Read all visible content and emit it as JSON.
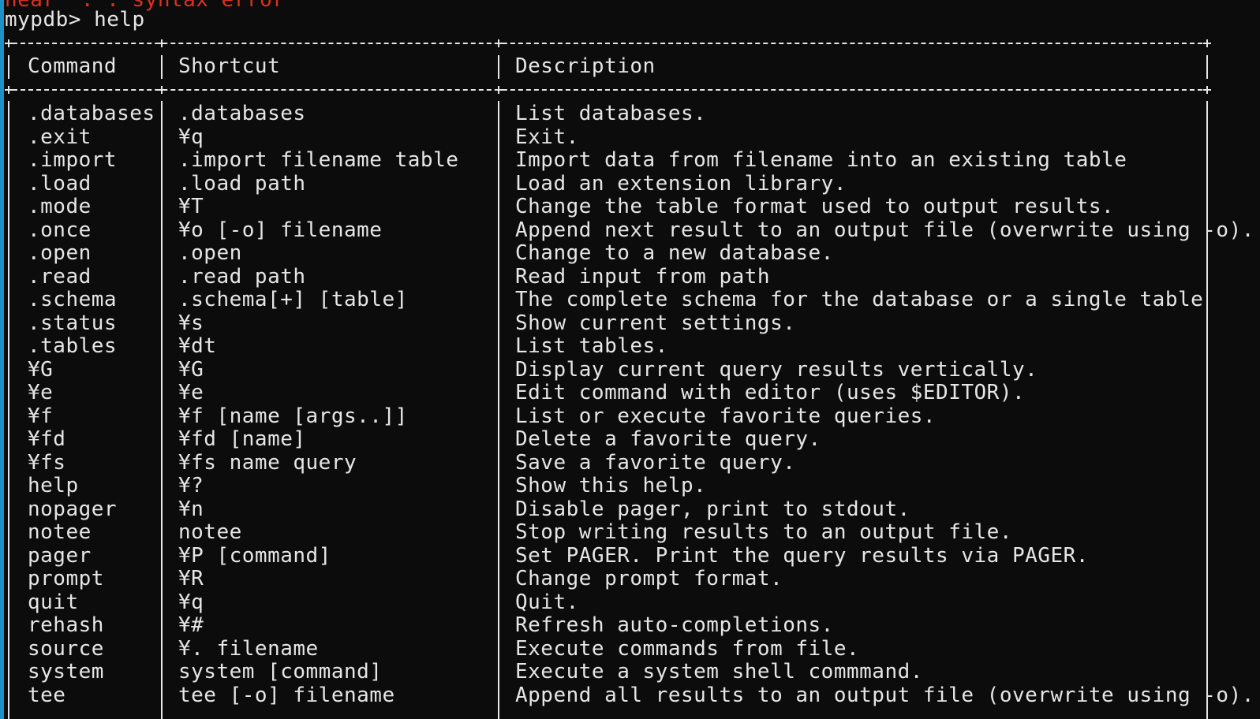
{
  "terminal": {
    "error_text": "near \".\": syntax error",
    "prompt": "mypdb> ",
    "command": "help"
  },
  "table": {
    "headers": [
      "Command",
      "Shortcut",
      "Description"
    ],
    "rows": [
      {
        "command": ".databases",
        "shortcut": ".databases",
        "description": "List databases."
      },
      {
        "command": ".exit",
        "shortcut": "¥q",
        "description": "Exit."
      },
      {
        "command": ".import",
        "shortcut": ".import filename table",
        "description": "Import data from filename into an existing table"
      },
      {
        "command": ".load",
        "shortcut": ".load path",
        "description": "Load an extension library."
      },
      {
        "command": ".mode",
        "shortcut": "¥T",
        "description": "Change the table format used to output results."
      },
      {
        "command": ".once",
        "shortcut": "¥o [-o] filename",
        "description": "Append next result to an output file (overwrite using -o)."
      },
      {
        "command": ".open",
        "shortcut": ".open",
        "description": "Change to a new database."
      },
      {
        "command": ".read",
        "shortcut": ".read path",
        "description": "Read input from path"
      },
      {
        "command": ".schema",
        "shortcut": ".schema[+] [table]",
        "description": "The complete schema for the database or a single table"
      },
      {
        "command": ".status",
        "shortcut": "¥s",
        "description": "Show current settings."
      },
      {
        "command": ".tables",
        "shortcut": "¥dt",
        "description": "List tables."
      },
      {
        "command": "¥G",
        "shortcut": "¥G",
        "description": "Display current query results vertically."
      },
      {
        "command": "¥e",
        "shortcut": "¥e",
        "description": "Edit command with editor (uses $EDITOR)."
      },
      {
        "command": "¥f",
        "shortcut": "¥f [name [args..]]",
        "description": "List or execute favorite queries."
      },
      {
        "command": "¥fd",
        "shortcut": "¥fd [name]",
        "description": "Delete a favorite query."
      },
      {
        "command": "¥fs",
        "shortcut": "¥fs name query",
        "description": "Save a favorite query."
      },
      {
        "command": "help",
        "shortcut": "¥?",
        "description": "Show this help."
      },
      {
        "command": "nopager",
        "shortcut": "¥n",
        "description": "Disable pager, print to stdout."
      },
      {
        "command": "notee",
        "shortcut": "notee",
        "description": "Stop writing results to an output file."
      },
      {
        "command": "pager",
        "shortcut": "¥P [command]",
        "description": "Set PAGER. Print the query results via PAGER."
      },
      {
        "command": "prompt",
        "shortcut": "¥R",
        "description": "Change prompt format."
      },
      {
        "command": "quit",
        "shortcut": "¥q",
        "description": "Quit."
      },
      {
        "command": "rehash",
        "shortcut": "¥#",
        "description": "Refresh auto-completions."
      },
      {
        "command": "source",
        "shortcut": "¥. filename",
        "description": "Execute commands from file."
      },
      {
        "command": "system",
        "shortcut": "system [command]",
        "description": "Execute a system shell commmand."
      },
      {
        "command": "tee",
        "shortcut": "tee [-o] filename",
        "description": "Append all results to an output file (overwrite using -o)."
      }
    ]
  },
  "colors": {
    "background": "#0c0c0c",
    "text": "#e6e6e6",
    "error": "#e0301e",
    "accent": "#1e90c8"
  }
}
